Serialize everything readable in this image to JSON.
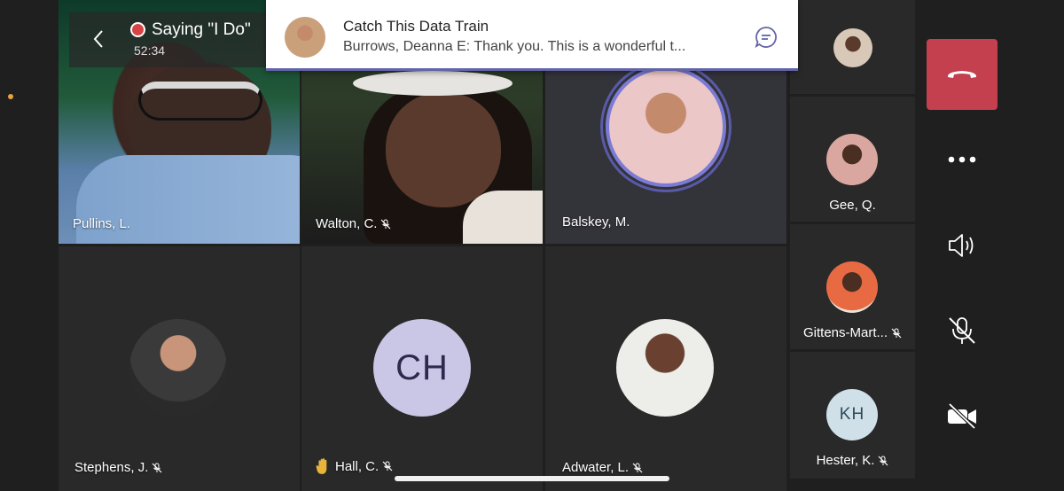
{
  "recording": {
    "title": "Saying \"I Do\"",
    "elapsed": "52:34"
  },
  "notification": {
    "title": "Catch This Data Train",
    "message": "Burrows, Deanna E: Thank you. This is a wonderful t..."
  },
  "grid": {
    "tiles": [
      {
        "name": "Pullins, L.",
        "muted": false
      },
      {
        "name": "Walton, C.",
        "muted": true
      },
      {
        "name": "Balskey, M.",
        "muted": false
      },
      {
        "name": "Stephens, J.",
        "muted": true
      },
      {
        "name": "Hall, C.",
        "muted": true,
        "initials": "CH",
        "hand_raised": true
      },
      {
        "name": "Adwater, L.",
        "muted": true
      }
    ]
  },
  "sidebar": {
    "tiles": [
      {
        "name": "",
        "muted": false
      },
      {
        "name": "Gee, Q.",
        "muted": false
      },
      {
        "name": "Gittens-Mart...",
        "muted": true
      },
      {
        "name": "Hester, K.",
        "muted": true,
        "initials": "KH"
      }
    ]
  },
  "controls": {
    "icons": [
      "hang-up-icon",
      "more-options-icon",
      "speaker-icon",
      "microphone-muted-icon",
      "camera-off-icon"
    ]
  },
  "colors": {
    "accent": "#6264a7",
    "hangup": "#c4404f",
    "background": "#1f1f1f",
    "tile": "#292929"
  }
}
